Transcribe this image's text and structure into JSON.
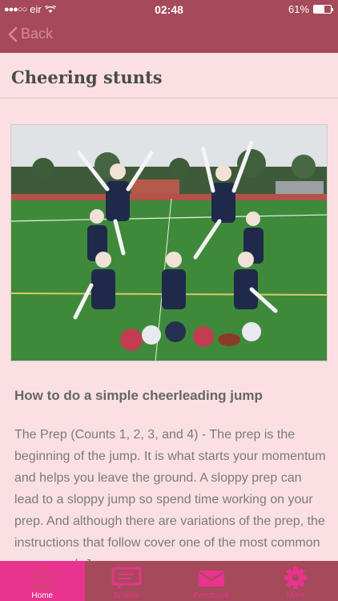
{
  "status_bar": {
    "carrier": "eir",
    "time": "02:48",
    "battery": "61%",
    "battery_level": 0.61
  },
  "nav": {
    "back_label": "Back"
  },
  "article": {
    "title": "Cheering stunts",
    "heading": "How to do a simple cheerleading jump",
    "body": "The Prep (Counts 1, 2, 3, and 4) -  The prep is the beginning of the jump. It is what starts your momentum and helps you leave the ground. A sloppy prep can lead to a sloppy jump so spend time working on your prep. And although there are variations of the prep, the instructions that follow cover one of the most common preps used. Jumps"
  },
  "tabs": [
    {
      "label": "Home",
      "icon": "home-icon",
      "active": true
    },
    {
      "label": "Browse",
      "icon": "chat-icon",
      "active": false
    },
    {
      "label": "Feedback",
      "icon": "mail-icon",
      "active": false
    },
    {
      "label": "More",
      "icon": "gear-icon",
      "active": false
    }
  ],
  "colors": {
    "brand": "#a6495b",
    "accent": "#e8338f",
    "background": "#fbe0e3"
  }
}
